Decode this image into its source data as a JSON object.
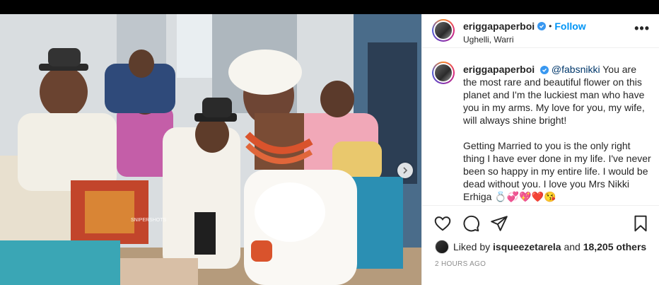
{
  "post": {
    "photo_watermark": "SNIPERSHOTS",
    "photo_description": "wedding-party-photo"
  },
  "header": {
    "username": "eriggapaperboi",
    "separator": "•",
    "follow_label": "Follow",
    "location": "Ughelli, Warri",
    "more_label": "•••"
  },
  "caption": {
    "username": "eriggapaperboi",
    "mention": "@fabsnikki",
    "paragraph1": " You are the most rare and beautiful flower on this planet and I'm the luckiest man who have you in my arms. My love for you, my wife, will always shine bright!",
    "paragraph2": "Getting Married to you is the only right thing I have ever done in my life. I've never been so happy in my entire life. I would be dead without you. I love you Mrs Nikki Erhiga 💍💞💖❤️😘"
  },
  "actions": {
    "like_icon": "heart-icon",
    "comment_icon": "comment-icon",
    "share_icon": "paper-plane-icon",
    "save_icon": "bookmark-icon"
  },
  "likes": {
    "prefix": "Liked by ",
    "user": "isqueezetarela",
    "middle": " and ",
    "others": "18,205 others"
  },
  "timestamp": "2 HOURS AGO",
  "colors": {
    "accent": "#0095f6",
    "verified": "#3897f0",
    "text": "#262626",
    "muted": "#8e8e8e"
  }
}
